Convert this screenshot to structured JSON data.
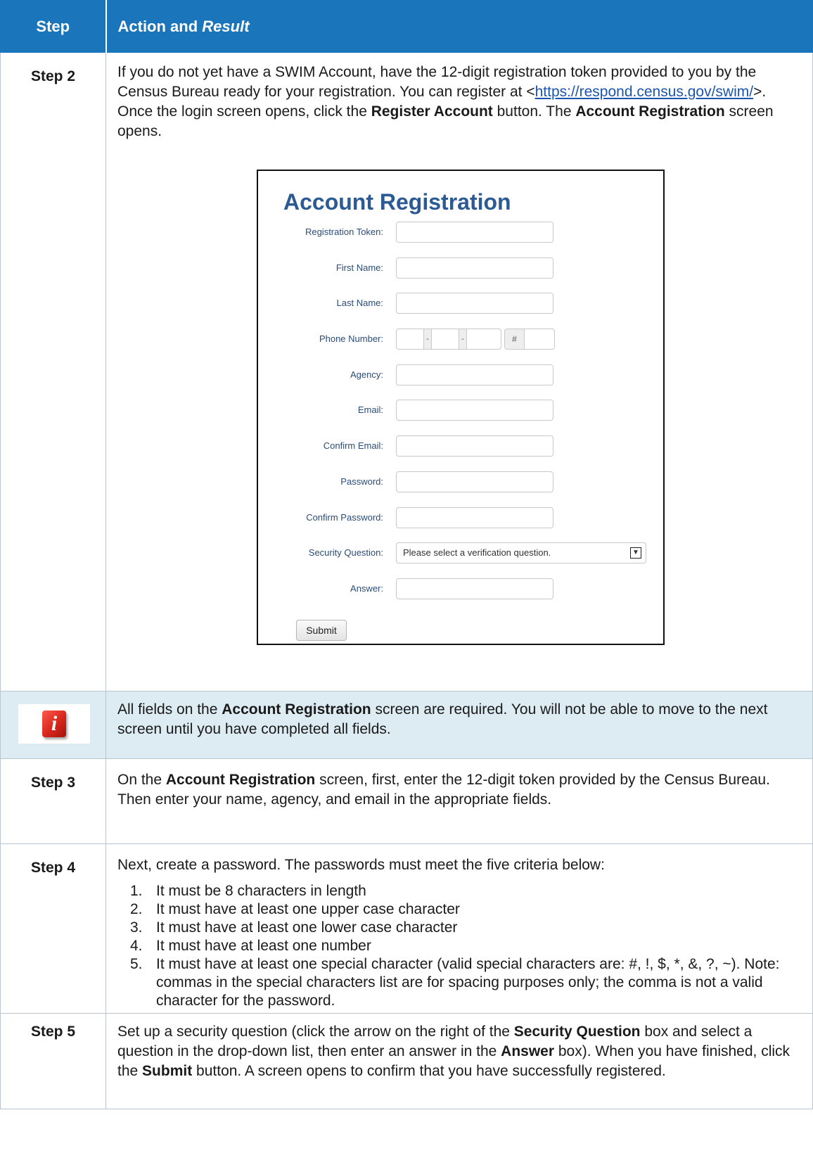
{
  "header": {
    "step": "Step",
    "action": "Action and ",
    "result": "Result"
  },
  "step2": {
    "label": "Step 2",
    "text_1": "If you do not yet have a SWIM Account, have the 12-digit registration token provided to you by the Census Bureau ready for your registration. You can register at <",
    "link": "https://respond.census.gov/swim/",
    "text_2": ">. Once the login screen opens, click the ",
    "bold_1": "Register Account",
    "text_3": " button. The ",
    "bold_2": "Account Registration",
    "text_4": " screen opens."
  },
  "form": {
    "title": "Account Registration",
    "labels": {
      "token": "Registration Token:",
      "first": "First Name:",
      "last": "Last Name:",
      "phone": "Phone Number:",
      "agency": "Agency:",
      "email": "Email:",
      "confirm_email": "Confirm Email:",
      "password": "Password:",
      "confirm_password": "Confirm Password:",
      "security": "Security Question:",
      "answer": "Answer:"
    },
    "phone_sep": "-",
    "phone_ext": "#",
    "security_placeholder": "Please select a verification question.",
    "submit": "Submit"
  },
  "note": {
    "icon": "info-icon",
    "text_1": "All fields on the ",
    "bold": "Account Registration",
    "text_2": " screen are required. You will not be able to move to the next screen until you have completed all fields."
  },
  "step3": {
    "label": "Step 3",
    "text_1": "On the ",
    "bold": "Account Registration",
    "text_2": " screen, first, enter the 12-digit token provided by the Census Bureau. Then enter your name, agency, and email in the appropriate fields."
  },
  "step4": {
    "label": "Step 4",
    "intro": "Next, create a password. The passwords must meet the five criteria below:",
    "criteria": [
      {
        "n": "1.",
        "text": "It must be 8 characters in length"
      },
      {
        "n": "2.",
        "text": "It must have at least one upper case character"
      },
      {
        "n": "3.",
        "text": "It must have at least one lower case character"
      },
      {
        "n": "4.",
        "text": "It must have at least one number"
      },
      {
        "n": "5.",
        "text": "It must have at least one special character (valid special characters are: #, !, $, *, &, ?, ~). Note: commas in the special characters list are for spacing purposes only; the comma is not a valid character for the password."
      }
    ]
  },
  "step5": {
    "label": "Step 5",
    "text_1": "Set up a security question (click the arrow on the right of the ",
    "bold_1": "Security Question",
    "text_2": " box and select a question in the drop-down list, then enter an answer in the ",
    "bold_2": "Answer",
    "text_3": " box). When you have finished, click the ",
    "bold_3": "Submit",
    "text_4": " button. A screen opens to confirm that you have successfully registered."
  },
  "colors": {
    "header_bg": "#1b75bb",
    "note_bg": "#ddebf3",
    "form_title": "#2b5a94",
    "link": "#1a56b0"
  }
}
